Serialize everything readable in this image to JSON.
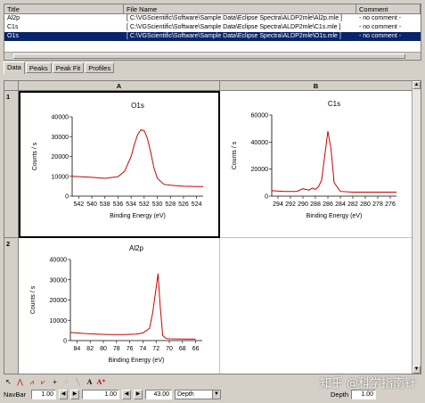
{
  "file_list": {
    "headers": [
      "Title",
      "File Name",
      "Comment"
    ],
    "rows": [
      {
        "title": "Al2p",
        "file": "[ C:\\VGScientific\\Software\\Sample Data\\Eclipse Spectra\\ALDP2mle\\Al2p.mle ]",
        "comment": "- no comment -",
        "selected": false
      },
      {
        "title": "C1s",
        "file": "[ C:\\VGScientific\\Software\\Sample Data\\Eclipse Spectra\\ALDP2mle\\C1s.mle ]",
        "comment": "- no comment -",
        "selected": false
      },
      {
        "title": "O1s",
        "file": "[ C:\\VGScientific\\Software\\Sample Data\\Eclipse Spectra\\ALDP2mle\\O1s.mle ]",
        "comment": "- no comment -",
        "selected": true
      }
    ]
  },
  "tabs": [
    "Data",
    "Peaks",
    "Peak Fit",
    "Profiles"
  ],
  "grid": {
    "columns": [
      "A",
      "B"
    ],
    "rows": [
      "1",
      "2"
    ]
  },
  "chart_data": [
    {
      "type": "line",
      "title": "O1s",
      "xlabel": "Binding Energy (eV)",
      "ylabel": "Counts / s",
      "x_ticks": [
        542,
        540,
        538,
        536,
        534,
        532,
        530,
        528,
        526,
        524
      ],
      "xlim": [
        543,
        523
      ],
      "y_ticks": [
        0,
        10000,
        20000,
        30000,
        40000
      ],
      "ylim": [
        0,
        40000
      ],
      "series": [
        {
          "x": [
            543,
            540,
            538,
            536,
            535,
            534,
            533.5,
            533,
            532.5,
            532,
            531.5,
            531,
            530.5,
            530,
            529,
            528,
            526,
            524,
            523
          ],
          "values": [
            10000,
            9500,
            9000,
            9800,
            12500,
            20000,
            26000,
            31000,
            33500,
            33000,
            29000,
            22000,
            14000,
            9000,
            6000,
            5500,
            5000,
            4800,
            4800
          ]
        }
      ]
    },
    {
      "type": "line",
      "title": "C1s",
      "xlabel": "Binding Energy (eV)",
      "ylabel": "Counts / s",
      "x_ticks": [
        294,
        292,
        290,
        288,
        286,
        284,
        282,
        280,
        278,
        276
      ],
      "xlim": [
        295,
        275
      ],
      "y_ticks": [
        0,
        20000,
        40000,
        60000
      ],
      "ylim": [
        0,
        60000
      ],
      "series": [
        {
          "x": [
            295,
            293,
            291,
            290,
            289,
            288.5,
            288,
            287.5,
            287,
            286.5,
            286,
            285.5,
            285,
            284,
            282,
            280,
            278,
            275
          ],
          "values": [
            4000,
            3500,
            3500,
            5500,
            4500,
            6000,
            5000,
            7000,
            12000,
            30000,
            48000,
            35000,
            10000,
            3500,
            3000,
            3000,
            3000,
            3000
          ]
        }
      ]
    },
    {
      "type": "line",
      "title": "Al2p",
      "xlabel": "Binding Energy (eV)",
      "ylabel": "Counts / s",
      "x_ticks": [
        84,
        82,
        80,
        78,
        76,
        74,
        72,
        70,
        68,
        66
      ],
      "xlim": [
        85,
        65
      ],
      "y_ticks": [
        0,
        10000,
        20000,
        30000,
        40000
      ],
      "ylim": [
        0,
        40000
      ],
      "series": [
        {
          "x": [
            85,
            83,
            81,
            79,
            77,
            75,
            74,
            73,
            72.5,
            72,
            71.7,
            71.4,
            71,
            70.5,
            70,
            68,
            66
          ],
          "values": [
            4000,
            3500,
            3200,
            3000,
            3000,
            3200,
            3800,
            6000,
            14000,
            26000,
            33000,
            18000,
            2500,
            1000,
            900,
            800,
            800
          ]
        }
      ]
    }
  ],
  "toolbar_icons": [
    "pointer-icon",
    "peak-icon",
    "peak-fit-icon",
    "peak-fit-icon",
    "add-icon",
    "grid-icon",
    "line-icon",
    "text-icon",
    "text-add-icon"
  ],
  "navbar": {
    "label": "NavBar",
    "value1": "1.00",
    "value2": "1.00",
    "value3": "43.00",
    "combo": "Depth",
    "depth_label": "Depth",
    "depth_value": "1.00"
  },
  "watermark": "知乎 @科学指南针",
  "colors": {
    "trace": "#cc0000",
    "selection": "#0a246a"
  }
}
